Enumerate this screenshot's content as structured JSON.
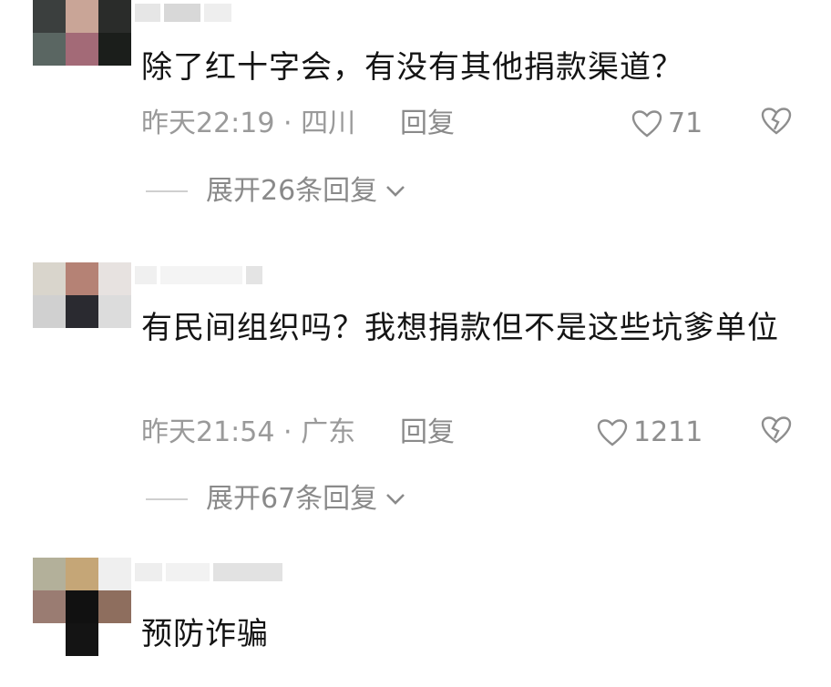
{
  "comments": [
    {
      "text": "除了红十字会，有没有其他捐款渠道？",
      "time_location": "昨天22:19 · 四川",
      "reply_label": "回复",
      "likes": "71",
      "expand_label": "展开26条回复"
    },
    {
      "text": "有民间组织吗？我想捐款但不是这些坑爹单位",
      "time_location": "昨天21:54 · 广东",
      "reply_label": "回复",
      "likes": "1211",
      "expand_label": "展开67条回复"
    },
    {
      "text": "预防诈骗"
    }
  ],
  "colors": {
    "text": "#141414",
    "meta": "#9a9a9a",
    "background": "#ffffff"
  },
  "icons": [
    "heart-outline-icon",
    "broken-heart-icon",
    "chevron-down-icon"
  ]
}
